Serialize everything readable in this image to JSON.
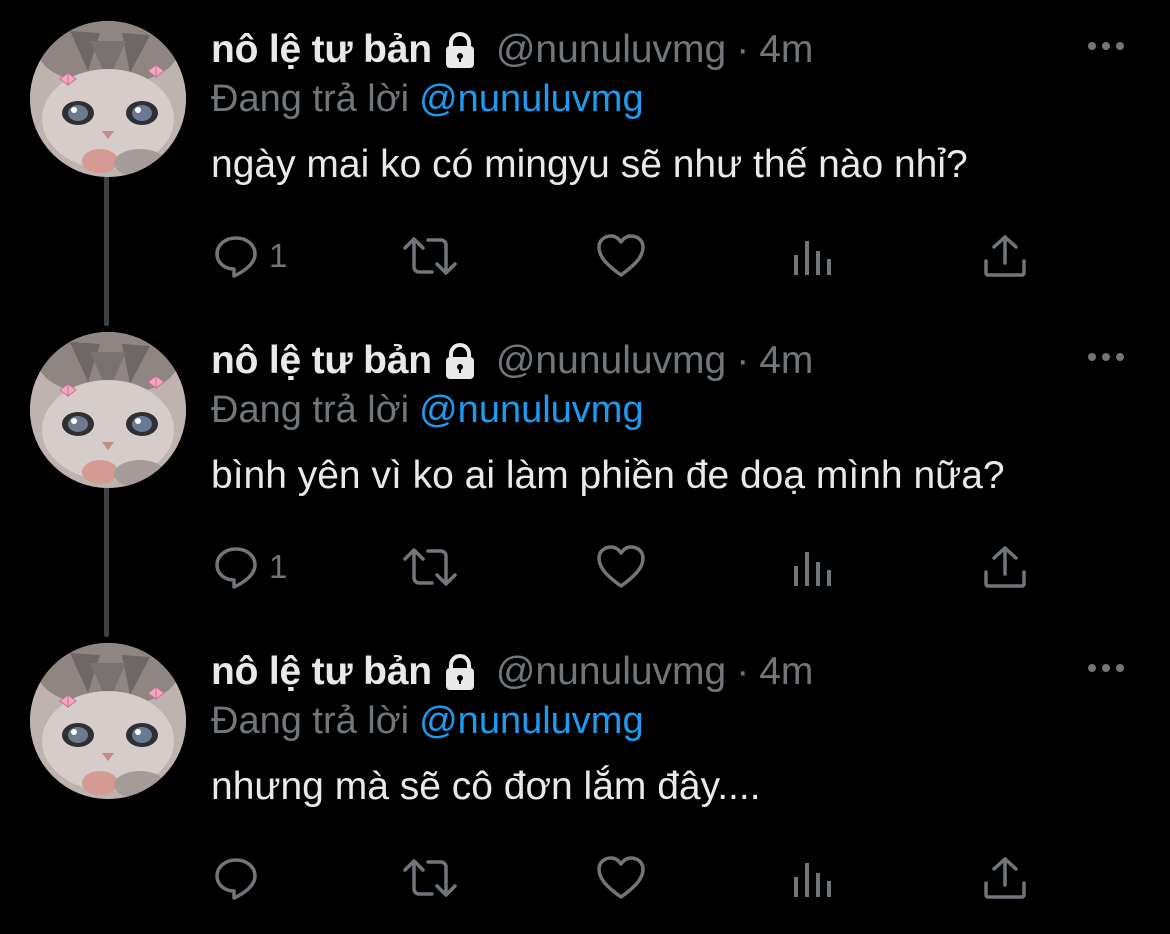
{
  "theme": {
    "background": "#000000",
    "text_primary": "#e7e9ea",
    "text_secondary": "#71767b",
    "accent": "#1d9bf0",
    "thread_line": "#3e4144"
  },
  "tweets": [
    {
      "author_name": "nô lệ tư bản",
      "protected_icon": "lock-icon",
      "handle": "@nunuluvmg",
      "separator": "·",
      "time": "4m",
      "reply_prefix": "Đang trả lời",
      "reply_to": "@nunuluvmg",
      "text": "ngày mai ko có mingyu sẽ như thế nào nhỉ?",
      "reply_count": "1",
      "actions": [
        "reply-icon",
        "retweet-icon",
        "like-icon",
        "views-icon",
        "share-icon"
      ]
    },
    {
      "author_name": "nô lệ tư bản",
      "protected_icon": "lock-icon",
      "handle": "@nunuluvmg",
      "separator": "·",
      "time": "4m",
      "reply_prefix": "Đang trả lời",
      "reply_to": "@nunuluvmg",
      "text": "bình yên vì ko ai làm phiền đe doạ mình nữa?",
      "reply_count": "1",
      "actions": [
        "reply-icon",
        "retweet-icon",
        "like-icon",
        "views-icon",
        "share-icon"
      ]
    },
    {
      "author_name": "nô lệ tư bản",
      "protected_icon": "lock-icon",
      "handle": "@nunuluvmg",
      "separator": "·",
      "time": "4m",
      "reply_prefix": "Đang trả lời",
      "reply_to": "@nunuluvmg",
      "text": "nhưng mà sẽ cô đơn lắm đây....",
      "reply_count": "",
      "actions": [
        "reply-icon",
        "retweet-icon",
        "like-icon",
        "views-icon",
        "share-icon"
      ]
    }
  ]
}
